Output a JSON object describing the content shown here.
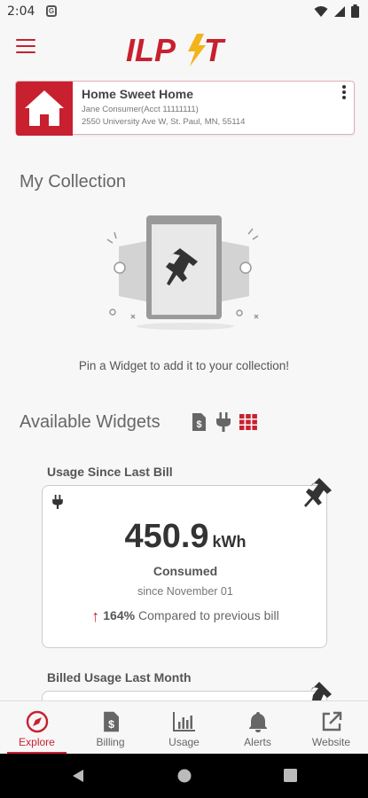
{
  "status_bar": {
    "time": "2:04",
    "sim_label": "G"
  },
  "brand": {
    "logo_text": "ILPT",
    "accent": "#c8202e"
  },
  "account": {
    "name": "Home Sweet Home",
    "holder": "Jane Consumer(Acct 11111111)",
    "address": "2550 University Ave W, St. Paul, MN, 55114"
  },
  "collection": {
    "title": "My Collection",
    "hint": "Pin a Widget to add it to your collection!"
  },
  "available": {
    "title": "Available Widgets",
    "filters": [
      "billing-filter-icon",
      "plug-filter-icon",
      "grid-filter-icon"
    ]
  },
  "widgets": [
    {
      "title": "Usage Since Last Bill",
      "value": "450.9",
      "unit": "kWh",
      "label": "Consumed",
      "since": "since November 01",
      "change_pct": "164%",
      "change_text": "Compared to previous bill"
    },
    {
      "title": "Billed Usage Last Month"
    }
  ],
  "bottom_nav": [
    {
      "label": "Explore",
      "icon": "compass-icon",
      "active": true
    },
    {
      "label": "Billing",
      "icon": "bill-icon",
      "active": false
    },
    {
      "label": "Usage",
      "icon": "bar-chart-icon",
      "active": false
    },
    {
      "label": "Alerts",
      "icon": "bell-icon",
      "active": false
    },
    {
      "label": "Website",
      "icon": "external-link-icon",
      "active": false
    }
  ]
}
